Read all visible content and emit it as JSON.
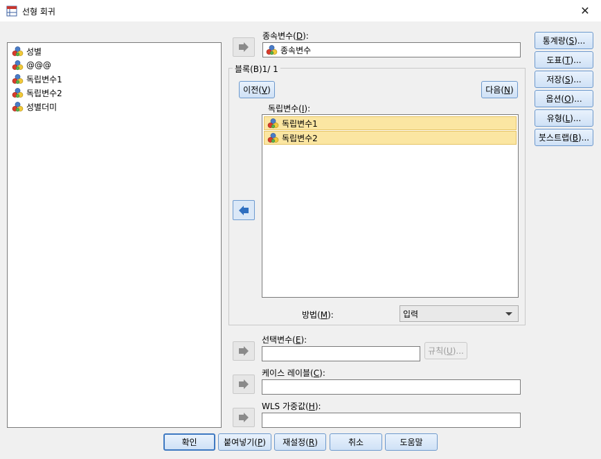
{
  "window": {
    "title": "선형 회귀",
    "close_glyph": "✕"
  },
  "source_variables": [
    "성별",
    "@@@",
    "독립변수1",
    "독립변수2",
    "성별더미"
  ],
  "dependent": {
    "label_prefix": "종속변수(",
    "label_key": "D",
    "label_suffix": "):",
    "value": "종속변수"
  },
  "block": {
    "legend": "블록(B)1/ 1",
    "prev": {
      "prefix": "이전(",
      "key": "V",
      "suffix": ")"
    },
    "next": {
      "prefix": "다음(",
      "key": "N",
      "suffix": ")"
    },
    "independents_label": {
      "prefix": "독립변수(",
      "key": "I",
      "suffix": "):"
    },
    "independents": [
      "독립변수1",
      "독립변수2"
    ],
    "method_label": {
      "prefix": "방법(",
      "key": "M",
      "suffix": "):"
    },
    "method_value": "입력"
  },
  "selection": {
    "label": {
      "prefix": "선택변수(",
      "key": "E",
      "suffix": "):"
    },
    "rule_button": {
      "prefix": "규칙(",
      "key": "U",
      "suffix": ")..."
    }
  },
  "case_label": {
    "prefix": "케이스 레이블(",
    "key": "C",
    "suffix": "):"
  },
  "wls": {
    "prefix": "WLS 가중값(",
    "key": "H",
    "suffix": "):"
  },
  "side_buttons": [
    {
      "prefix": "통계량(",
      "key": "S",
      "suffix": ")..."
    },
    {
      "prefix": "도표(",
      "key": "T",
      "suffix": ")..."
    },
    {
      "prefix": "저장(",
      "key": "S",
      "suffix": ")..."
    },
    {
      "prefix": "옵션(",
      "key": "O",
      "suffix": ")..."
    },
    {
      "prefix": "유형(",
      "key": "L",
      "suffix": ")..."
    },
    {
      "prefix": "붓스트랩(",
      "key": "B",
      "suffix": ")..."
    }
  ],
  "bottom_buttons": {
    "ok": "확인",
    "paste": {
      "prefix": "붙여넣기(",
      "key": "P",
      "suffix": ")"
    },
    "reset": {
      "prefix": "재설정(",
      "key": "R",
      "suffix": ")"
    },
    "cancel": "취소",
    "help": "도움말"
  },
  "colors": {
    "accent": "#3d78c1",
    "selection_bg": "#fbe6a2",
    "arrow_active": "#2f6fc0"
  }
}
